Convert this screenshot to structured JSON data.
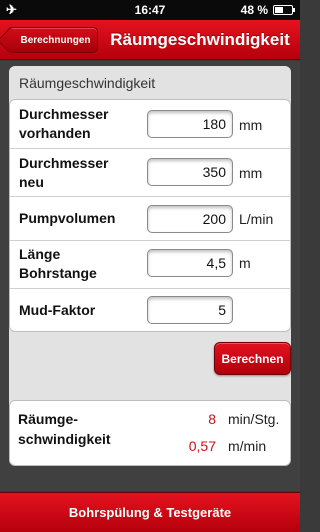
{
  "status_bar": {
    "left_icon": "airplane-icon",
    "left_glyph": "✈",
    "time": "16:47",
    "battery": "48 %",
    "battery_level": 0.48
  },
  "nav": {
    "back_label": "Berechnungen",
    "title": "Räumgeschwindigkeit"
  },
  "section_title": "Räumgeschwindigkeit",
  "form": {
    "rows": [
      {
        "label": "Durchmesser\nvorhanden",
        "value": "180",
        "unit": "mm"
      },
      {
        "label": "Durchmesser\nneu",
        "value": "350",
        "unit": "mm"
      },
      {
        "label": "Pumpvolumen",
        "value": "200",
        "unit": "L/min"
      },
      {
        "label": "Länge\nBohrstange",
        "value": "4,5",
        "unit": "m"
      },
      {
        "label": "Mud-Faktor",
        "value": "5",
        "unit": ""
      }
    ]
  },
  "calculate_label": "Berechnen",
  "result": {
    "label": "Räumge-\nschwindigkeit",
    "values": [
      {
        "value": "8",
        "unit": "min/Stg."
      },
      {
        "value": "0,57",
        "unit": "m/min"
      }
    ]
  },
  "footer_label": "Bohrspülung & Testgeräte",
  "colors": {
    "accent": "#c8101c",
    "nav_red": "#d50f1b"
  }
}
